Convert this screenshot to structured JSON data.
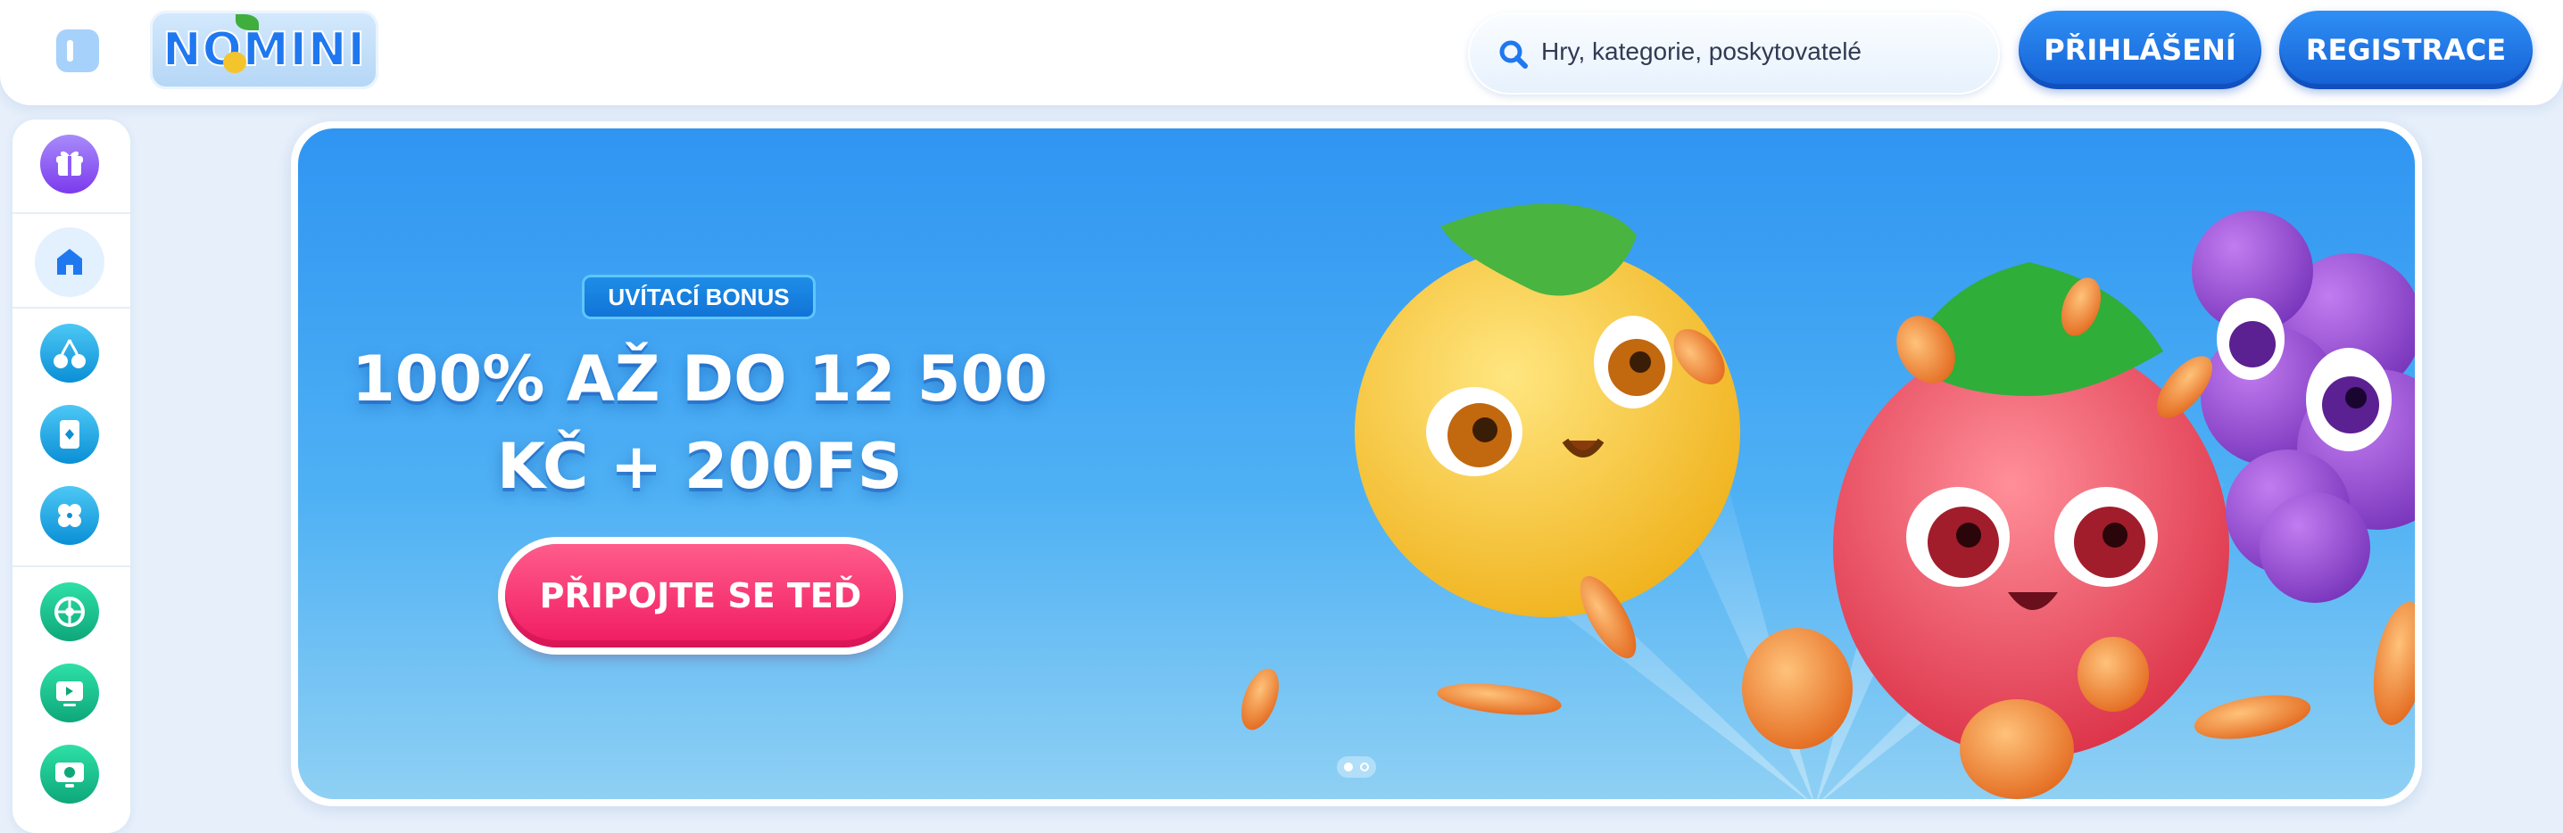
{
  "header": {
    "logo_text": "NOMINI",
    "search": {
      "placeholder": "Hry, kategorie, poskytovatelé"
    },
    "login_label": "PŘIHLÁŠENÍ",
    "register_label": "REGISTRACE"
  },
  "sidebar": {
    "items": [
      {
        "icon": "gift-icon",
        "color": "#8b5cf6"
      },
      {
        "icon": "home-icon",
        "color": "#1f78f0",
        "active": true
      },
      {
        "icon": "cherries-icon",
        "color": "#16a6e8"
      },
      {
        "icon": "card-icon",
        "color": "#16a6e8"
      },
      {
        "icon": "clover-icon",
        "color": "#16a6e8"
      },
      {
        "icon": "roulette-icon",
        "color": "#13b886"
      },
      {
        "icon": "live-play-icon",
        "color": "#13b886"
      },
      {
        "icon": "tv-game-icon",
        "color": "#13b886"
      }
    ]
  },
  "hero": {
    "badge": "UVÍTACÍ BONUS",
    "headline_line1": "100% AŽ DO 12 500",
    "headline_line2": "KČ + 200FS",
    "cta_label": "PŘIPOJTE SE TEĎ",
    "slides_total": 2,
    "slide_active": 1
  },
  "colors": {
    "primary_button": "#1f78f0",
    "cta": "#f42a6b",
    "page_background": "#e6effa"
  }
}
